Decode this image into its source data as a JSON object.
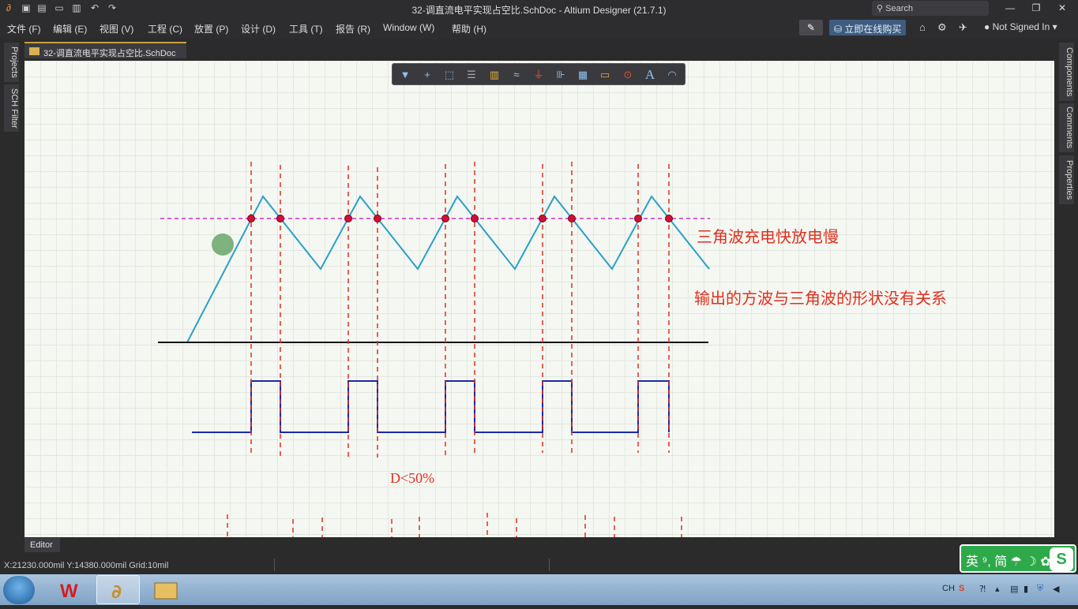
{
  "window": {
    "title": "32-调直流电平实现占空比.SchDoc - Altium Designer (21.7.1)",
    "search_placeholder": "Search",
    "minimize": "—",
    "restore": "❐",
    "close": "✕"
  },
  "menu": {
    "items": [
      "文件 (F)",
      "编辑 (E)",
      "视图 (V)",
      "工程 (C)",
      "放置 (P)",
      "设计 (D)",
      "工具 (T)",
      "报告 (R)",
      "Window (W)",
      "帮助 (H)"
    ],
    "buy_button": "立即在线购买",
    "user": "Not Signed In"
  },
  "left_panels": [
    "Projects",
    "SCH Filter"
  ],
  "right_panels": [
    "Components",
    "Comments",
    "Properties"
  ],
  "doc_tab": "32-调直流电平实现占空比.SchDoc",
  "toolbar_icons": [
    "filter-icon",
    "cross-icon",
    "select-rect-icon",
    "align-icon",
    "component-icon",
    "wire-icon",
    "ground-icon",
    "bus-icon",
    "net-label-icon",
    "port-icon",
    "param-icon",
    "text-icon",
    "arc-icon"
  ],
  "annotations": {
    "triangle_note": "三角波充电快放电慢",
    "output_note": "输出的方波与三角波的形状没有关系",
    "duty": "D<50%"
  },
  "editor_tab": "Editor",
  "status": {
    "text": "X:21230.000mil Y:14380.000mil   Grid:10mil"
  },
  "ime": {
    "label": "英 ⁹, 简 ☂ ☽ ✿",
    "logo": "S"
  },
  "tray": {
    "lang": "CH"
  },
  "colors": {
    "triangle": "#2aa0c8",
    "threshold": "#cc33cc",
    "marker_line": "#e03020",
    "square": "#1a2aa8",
    "accent": "#3d5c80"
  }
}
